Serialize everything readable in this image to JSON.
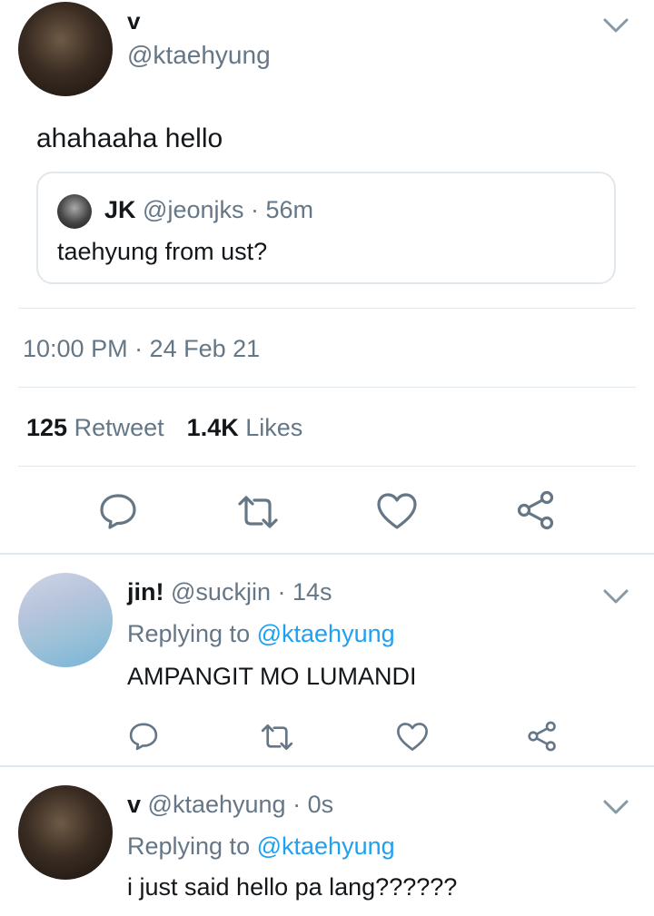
{
  "main_tweet": {
    "display_name": "v",
    "handle": "@ktaehyung",
    "text": "ahahaaha hello",
    "quoted": {
      "display_name": "JK",
      "handle": "@jeonjks",
      "time": "· 56m",
      "text": "taehyung from ust?"
    },
    "timestamp": "10:00 PM · 24 Feb 21",
    "retweet_count": "125",
    "retweet_label": "Retweet",
    "likes_count": "1.4K",
    "likes_label": "Likes"
  },
  "replies": [
    {
      "display_name": "jin!",
      "handle": "@suckjin",
      "time": "· 14s",
      "replying_prefix": "Replying to",
      "replying_handle": "@ktaehyung",
      "text": "AMPANGIT MO LUMANDI"
    },
    {
      "display_name": "v",
      "handle": "@ktaehyung",
      "time": "· 0s",
      "replying_prefix": "Replying to",
      "replying_handle": "@ktaehyung",
      "text": "i just said hello pa lang??????"
    }
  ],
  "colors": {
    "accent": "#1da1f2",
    "muted": "#657786",
    "divider": "#e1e8ed",
    "icon": "#657786"
  },
  "icons": [
    "chevron-down-icon",
    "reply-icon",
    "retweet-icon",
    "like-icon",
    "share-icon"
  ]
}
